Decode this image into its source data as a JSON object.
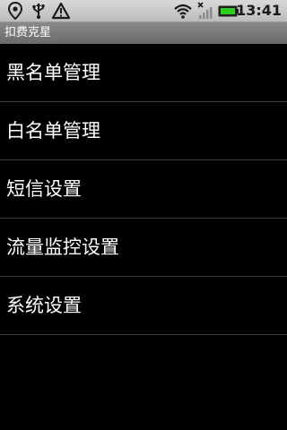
{
  "status_bar": {
    "time": "13:41",
    "icons": [
      "location-pin-icon",
      "usb-icon",
      "warning-icon",
      "wifi-icon",
      "no-signal-icon",
      "battery-icon"
    ],
    "battery_color": "#2ecc1f"
  },
  "app": {
    "title": "扣费克星"
  },
  "menu": {
    "items": [
      {
        "label": "黑名单管理"
      },
      {
        "label": "白名单管理"
      },
      {
        "label": "短信设置"
      },
      {
        "label": "流量监控设置"
      },
      {
        "label": "系统设置"
      }
    ]
  }
}
